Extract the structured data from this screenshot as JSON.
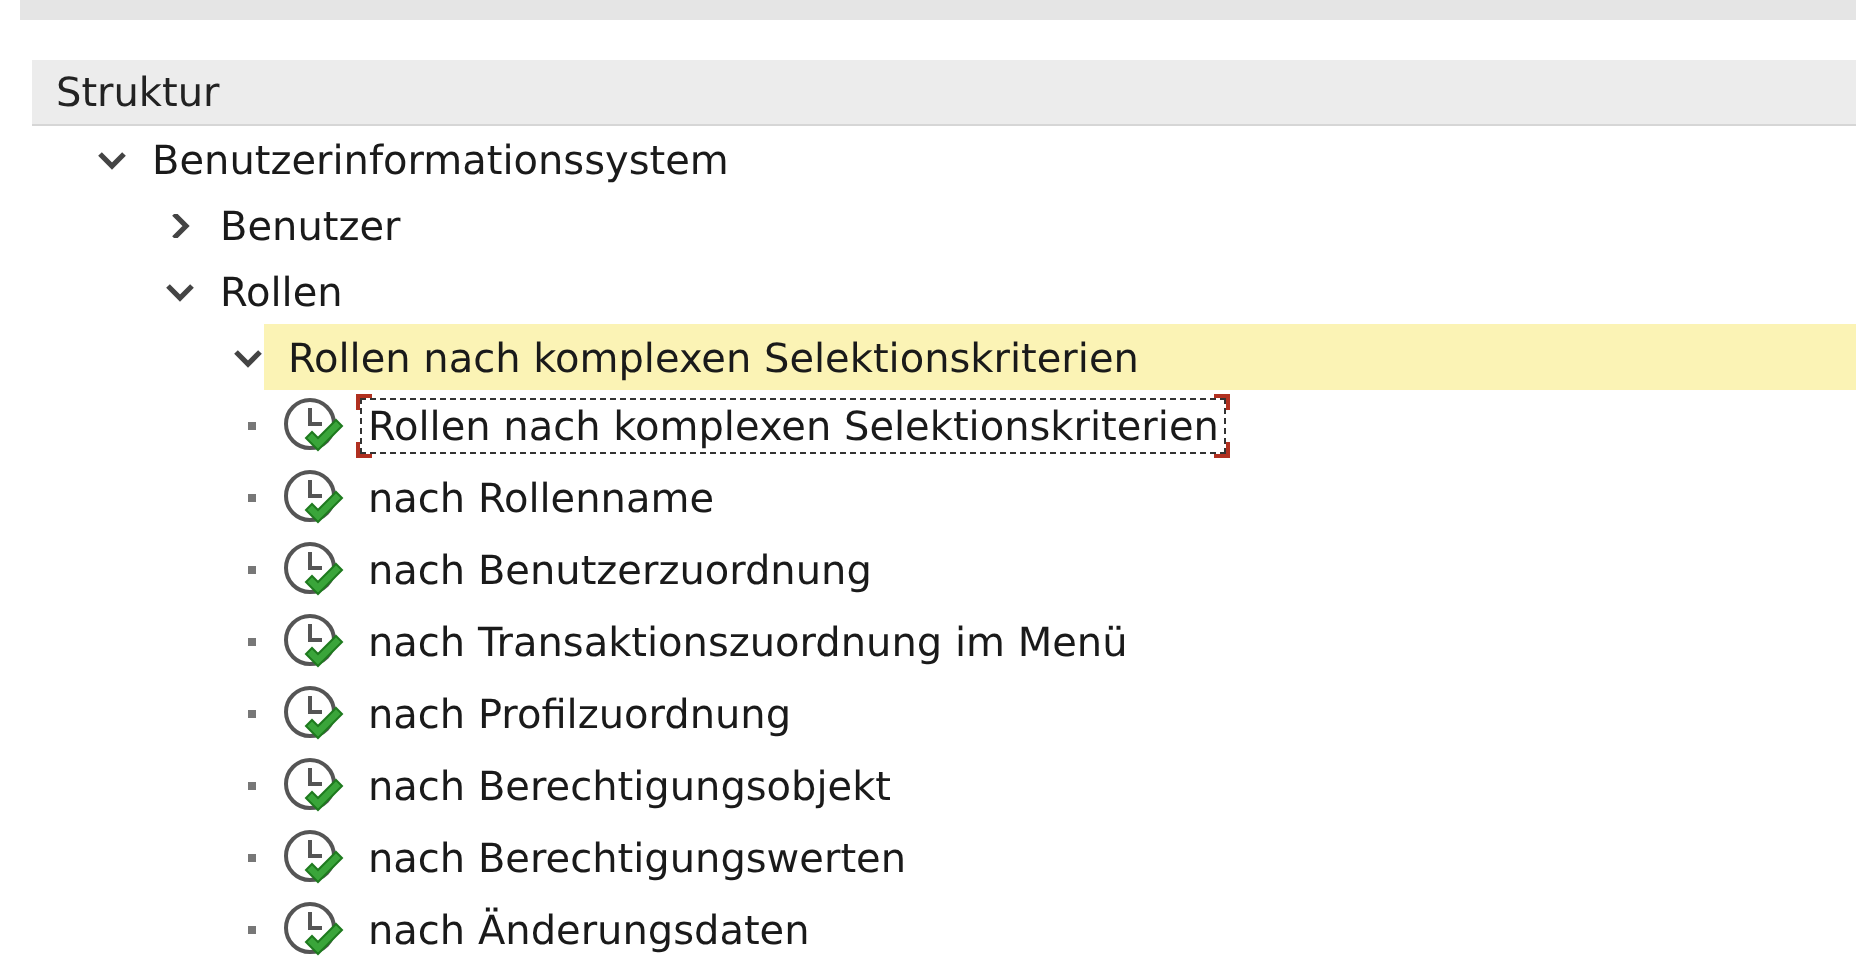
{
  "panel": {
    "header": "Struktur"
  },
  "tree": [
    {
      "label": "Benutzerinformationssystem",
      "expanded": true,
      "selected": false,
      "children": [
        {
          "label": "Benutzer",
          "expanded": false,
          "selected": false
        },
        {
          "label": "Rollen",
          "expanded": true,
          "selected": false,
          "children": [
            {
              "label": "Rollen nach komplexen Selektionskriterien",
              "expanded": true,
              "selected": true,
              "children": [
                {
                  "label": "Rollen nach komplexen Selektionskriterien",
                  "kind": "report",
                  "selected": false,
                  "focused": true
                },
                {
                  "label": "nach Rollenname",
                  "kind": "report",
                  "selected": false,
                  "focused": false
                },
                {
                  "label": "nach Benutzerzuordnung",
                  "kind": "report",
                  "selected": false,
                  "focused": false
                },
                {
                  "label": "nach Transaktionszuordnung im Menü",
                  "kind": "report",
                  "selected": false,
                  "focused": false
                },
                {
                  "label": "nach Profilzuordnung",
                  "kind": "report",
                  "selected": false,
                  "focused": false
                },
                {
                  "label": "nach Berechtigungsobjekt",
                  "kind": "report",
                  "selected": false,
                  "focused": false
                },
                {
                  "label": "nach Berechtigungswerten",
                  "kind": "report",
                  "selected": false,
                  "focused": false
                },
                {
                  "label": "nach Änderungsdaten",
                  "kind": "report",
                  "selected": false,
                  "focused": false
                }
              ]
            }
          ]
        }
      ]
    }
  ]
}
